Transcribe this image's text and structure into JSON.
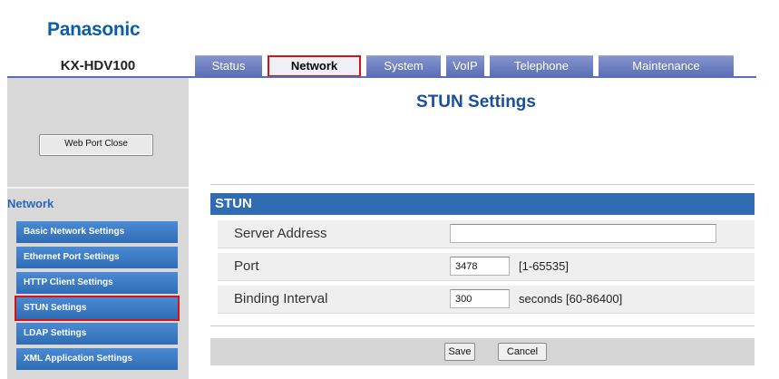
{
  "brand": "Panasonic",
  "model": "KX-HDV100",
  "tabs": [
    {
      "label": "Status"
    },
    {
      "label": "Network"
    },
    {
      "label": "System"
    },
    {
      "label": "VoIP"
    },
    {
      "label": "Telephone"
    },
    {
      "label": "Maintenance"
    }
  ],
  "sidebar": {
    "web_port_close": "Web Port Close",
    "section_title": "Network",
    "items": [
      {
        "label": "Basic Network Settings"
      },
      {
        "label": "Ethernet Port Settings"
      },
      {
        "label": "HTTP Client Settings"
      },
      {
        "label": "STUN Settings"
      },
      {
        "label": "LDAP Settings"
      },
      {
        "label": "XML Application Settings"
      }
    ]
  },
  "page_title": "STUN Settings",
  "section": {
    "title": "STUN",
    "server_address": {
      "label": "Server Address",
      "value": ""
    },
    "port": {
      "label": "Port",
      "value": "3478",
      "hint": "[1-65535]"
    },
    "binding_interval": {
      "label": "Binding Interval",
      "value": "300",
      "hint": "seconds [60-86400]"
    }
  },
  "buttons": {
    "save": "Save",
    "cancel": "Cancel"
  },
  "colors": {
    "accent": "#2f6cb3",
    "tab": "#5c6fb6",
    "highlight": "#dd1111",
    "brand": "#0a5fa8"
  }
}
